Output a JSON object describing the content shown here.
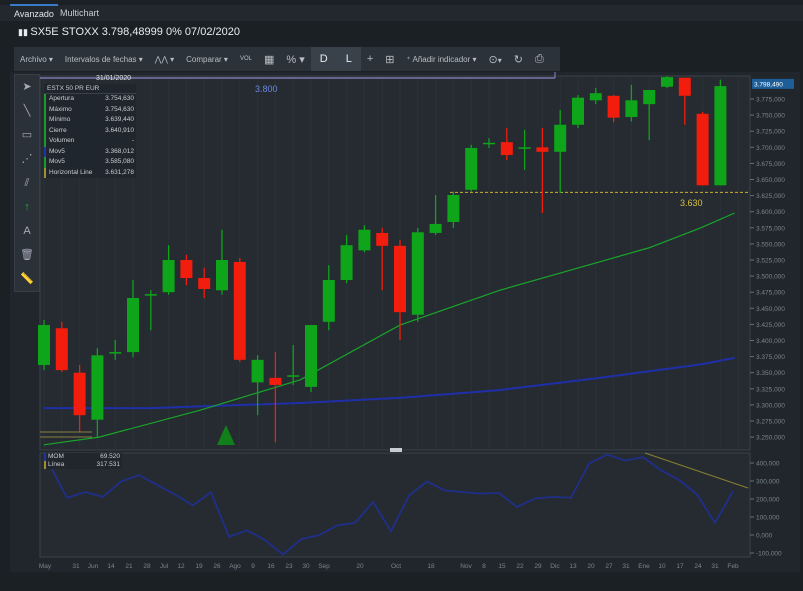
{
  "tabs": [
    {
      "label": "Avanzado",
      "active": true
    },
    {
      "label": "Multichart",
      "active": false
    }
  ],
  "title": "SX5E STOXX 3.798,48999 0% 07/02/2020",
  "toolbar": {
    "archivo": "Archivo ▾",
    "intervalos": "Intervalos de fechas ▾",
    "chart_type": "▾",
    "comparar": "Comparar ▾",
    "vol": "VOL",
    "percent": "% ▾",
    "d": "D",
    "l": "L",
    "add_indicator": "Añadir indicador ▾",
    "zoom": "▾"
  },
  "legend": {
    "date": "31/01/2020",
    "instrument": "ESTX 50 PR EUR",
    "rows": [
      {
        "label": "Apertura",
        "value": "3.754,630",
        "color": "#1a9a2a"
      },
      {
        "label": "Máximo",
        "value": "3.754,630",
        "color": "#1a9a2a"
      },
      {
        "label": "Mínimo",
        "value": "3.639,440",
        "color": "#1a9a2a"
      },
      {
        "label": "Cierre",
        "value": "3.640,910",
        "color": "#1a9a2a"
      },
      {
        "label": "Volumen",
        "value": "-",
        "color": "#1a9a2a"
      },
      {
        "label": "Mov5",
        "value": "3.368,012",
        "color": "#2233aa"
      },
      {
        "label": "Mov5",
        "value": "3.585,080",
        "color": "#1a9a2a"
      },
      {
        "label": "Horizontal Line",
        "value": "3.631,278",
        "color": "#a09030"
      }
    ]
  },
  "annotations": {
    "level_top": "3.800",
    "level_line": "3.630",
    "last_price": "3.798,490"
  },
  "colors": {
    "up": "#0fa51a",
    "down": "#f21d0c",
    "ma_long": "#1f2fa8",
    "ma_short": "#1aa52a",
    "hline": "#c8b030"
  },
  "chart_data": {
    "type": "candlestick",
    "ylim": [
      3240,
      3815
    ],
    "yticks": [
      "3.775,000",
      "3.750,000",
      "3.725,000",
      "3.700,000",
      "3.675,000",
      "3.650,000",
      "3.625,000",
      "3.600,000",
      "3.575,000",
      "3.550,000",
      "3.525,000",
      "3.500,000",
      "3.475,000",
      "3.450,000",
      "3.425,000",
      "3.400,000",
      "3.375,000",
      "3.350,000",
      "3.325,000",
      "3.300,000",
      "3.275,000",
      "3.250,000"
    ],
    "ytick_values": [
      3775,
      3750,
      3725,
      3700,
      3675,
      3650,
      3625,
      3600,
      3575,
      3550,
      3525,
      3500,
      3475,
      3450,
      3425,
      3400,
      3375,
      3350,
      3325,
      3300,
      3275,
      3250
    ],
    "candles_ohlc": [
      [
        3362,
        3432,
        3354,
        3424
      ],
      [
        3419,
        3429,
        3351,
        3354
      ],
      [
        3350,
        3362,
        3258,
        3284
      ],
      [
        3277,
        3388,
        3250,
        3377
      ],
      [
        3382,
        3401,
        3370,
        3382
      ],
      [
        3382,
        3494,
        3374,
        3466
      ],
      [
        3472,
        3478,
        3416,
        3472
      ],
      [
        3475,
        3548,
        3471,
        3525
      ],
      [
        3525,
        3533,
        3486,
        3497
      ],
      [
        3497,
        3513,
        3466,
        3480
      ],
      [
        3478,
        3572,
        3471,
        3525
      ],
      [
        3522,
        3528,
        3367,
        3370
      ],
      [
        3335,
        3377,
        3284,
        3370
      ],
      [
        3342,
        3382,
        3242,
        3331
      ],
      [
        3346,
        3393,
        3331,
        3346
      ],
      [
        3328,
        3424,
        3320,
        3424
      ],
      [
        3429,
        3517,
        3416,
        3494
      ],
      [
        3494,
        3564,
        3489,
        3548
      ],
      [
        3540,
        3579,
        3537,
        3572
      ],
      [
        3567,
        3575,
        3478,
        3547
      ],
      [
        3547,
        3556,
        3401,
        3444
      ],
      [
        3440,
        3575,
        3429,
        3568
      ],
      [
        3567,
        3626,
        3564,
        3581
      ],
      [
        3584,
        3631,
        3575,
        3626
      ],
      [
        3634,
        3704,
        3631,
        3699
      ],
      [
        3707,
        3714,
        3699,
        3707
      ],
      [
        3708,
        3730,
        3680,
        3688
      ],
      [
        3700,
        3727,
        3665,
        3700
      ],
      [
        3700,
        3730,
        3598,
        3693
      ],
      [
        3693,
        3758,
        3629,
        3735
      ],
      [
        3735,
        3781,
        3730,
        3777
      ],
      [
        3773,
        3792,
        3767,
        3784
      ],
      [
        3780,
        3781,
        3739,
        3746
      ],
      [
        3747,
        3797,
        3740,
        3773
      ],
      [
        3767,
        3789,
        3711,
        3789
      ],
      [
        3794,
        3812,
        3792,
        3809
      ],
      [
        3808,
        3808,
        3735,
        3780
      ],
      [
        3752,
        3755,
        3641,
        3641
      ],
      [
        3641,
        3805,
        3641,
        3795
      ]
    ],
    "ma_short": [
      [
        0,
        3238
      ],
      [
        3.1,
        3250
      ],
      [
        8.8,
        3292
      ],
      [
        14.4,
        3339
      ],
      [
        20,
        3424
      ],
      [
        25.6,
        3478
      ],
      [
        31.2,
        3522
      ],
      [
        34,
        3544
      ],
      [
        36.9,
        3575
      ],
      [
        38.8,
        3598
      ]
    ],
    "ma_long": [
      [
        0,
        3295
      ],
      [
        6,
        3295
      ],
      [
        14.4,
        3303
      ],
      [
        20,
        3311
      ],
      [
        25.6,
        3323
      ],
      [
        31.2,
        3342
      ],
      [
        36.9,
        3363
      ],
      [
        38.8,
        3373
      ]
    ],
    "hline": 3630,
    "signal_marker_index": 10,
    "mom": {
      "labels": [
        {
          "label": "MOM",
          "value": "69.520"
        },
        {
          "label": "Línea",
          "value": "317.531"
        }
      ],
      "ylim": [
        -120,
        460
      ],
      "yticks": [
        "400,000",
        "300,000",
        "200,000",
        "100,000",
        "0,000",
        "-100,000"
      ],
      "ytick_values": [
        400,
        300,
        200,
        100,
        0,
        -100
      ],
      "values": [
        396,
        207,
        238,
        212,
        297,
        333,
        279,
        225,
        165,
        238,
        -10,
        26,
        -28,
        -109,
        -24,
        -1,
        53,
        68,
        183,
        21,
        219,
        297,
        247,
        238,
        230,
        234,
        156,
        203,
        212,
        207,
        396,
        447,
        414,
        432,
        360,
        306,
        225,
        68,
        243
      ]
    },
    "xticks": [
      "May",
      "31",
      "Jun",
      "14",
      "21",
      "28",
      "Jul",
      "12",
      "19",
      "26",
      "Ago",
      "9",
      "16",
      "23",
      "30",
      "Sep",
      "20",
      "Oct",
      "18",
      "Nov",
      "8",
      "15",
      "22",
      "29",
      "Dic",
      "13",
      "20",
      "27",
      "31",
      "Ene",
      "10",
      "17",
      "24",
      "31",
      "Feb"
    ]
  }
}
